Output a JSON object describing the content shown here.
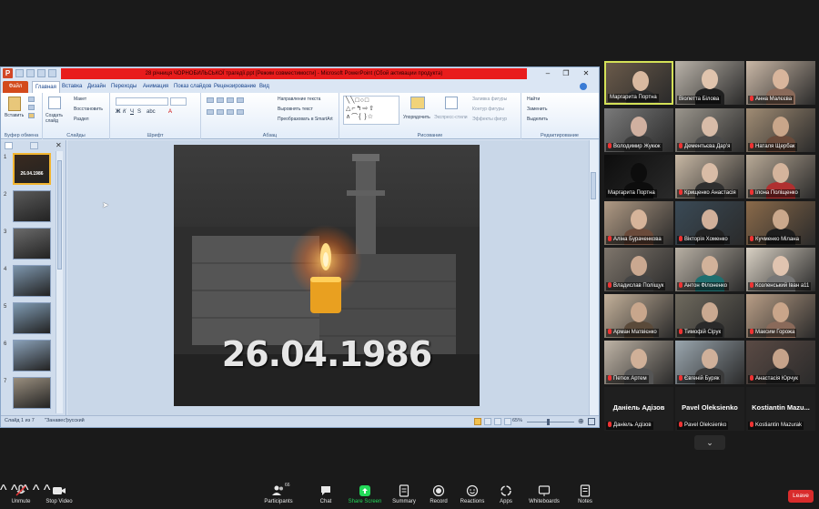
{
  "ppt": {
    "title": "28 річниця ЧОРНОБИЛЬСЬКОЇ трагедії.ppt [Режим совместимости] - Microsoft PowerPoint (Сбой активации продукта)",
    "tabs": [
      "Файл",
      "Главная",
      "Вставка",
      "Дизайн",
      "Переходы",
      "Анимация",
      "Показ слайдов",
      "Рецензирование",
      "Вид"
    ],
    "active_tab": "Главная",
    "ribbon": {
      "paste": "Вставить",
      "clipboard": "Буфер обмена",
      "new_slide": "Создать слайд",
      "layout": "Макет",
      "reset": "Восстановить",
      "section": "Раздел",
      "slides": "Слайды",
      "font": "Шрифт",
      "paragraph": "Абзац",
      "text_direction": "Направление текста",
      "align_text": "Выровнять текст",
      "smartart": "Преобразовать в SmartArt",
      "arrange": "Упорядочить",
      "quick_styles": "Экспресс-стили",
      "shape_fill": "Заливка фигуры",
      "shape_outline": "Контур фигуры",
      "shape_effects": "Эффекты фигур",
      "drawing": "Рисование",
      "find": "Найти",
      "replace": "Заменить",
      "select": "Выделить",
      "editing": "Редактирование"
    },
    "thumbnails": [
      {
        "num": "1",
        "label": "26.04.1986",
        "color": "#3a2a1f"
      },
      {
        "num": "2",
        "label": "",
        "color": "#5a5a5a"
      },
      {
        "num": "3",
        "label": "",
        "color": "#6b6b6b"
      },
      {
        "num": "4",
        "label": "",
        "color": "#7d96ad"
      },
      {
        "num": "5",
        "label": "",
        "color": "#7f9bb3"
      },
      {
        "num": "6",
        "label": "",
        "color": "#8aa1b8"
      },
      {
        "num": "7",
        "label": "",
        "color": "#9a8f7f"
      }
    ],
    "slide_date": "26.04.1986",
    "status": {
      "slide": "Слайд 1 из 7",
      "theme": "\"Занавес\"",
      "lang": "русский",
      "zoom": "65%"
    }
  },
  "participants": [
    {
      "name": "Маргарита Портна",
      "mic": false,
      "active": true,
      "bg": "#6a5a4a",
      "skin": "#d9b9a0",
      "shirt": "#2d2d2d"
    },
    {
      "name": "Віолетта Білова",
      "mic": false,
      "bg": "#b9b2a8",
      "skin": "#e0c4ad",
      "shirt": "#1f1f1f"
    },
    {
      "name": "Анна Малєєва",
      "mic": true,
      "bg": "#c9b7a6",
      "skin": "#d8b59c",
      "shirt": "#8a6a5a"
    },
    {
      "name": "Володимир Жукюк",
      "mic": true,
      "bg": "#7a7a7a",
      "skin": "#d0b0a0",
      "shirt": "#3a3a3a"
    },
    {
      "name": "Дементьєва Дар'я",
      "mic": true,
      "bg": "#9a958c",
      "skin": "#d8bca8",
      "shirt": "#4a4a4a"
    },
    {
      "name": "Наталя Щербак",
      "mic": true,
      "bg": "#a08c74",
      "skin": "#c9a68a",
      "shirt": "#6a4a3a"
    },
    {
      "name": "Маргарита Портна",
      "mic": false,
      "bg": "#0d0d0d",
      "skin": "#0d0d0d",
      "shirt": "#0d0d0d"
    },
    {
      "name": "Крищенко Анастасія",
      "mic": true,
      "bg": "#c8b8a4",
      "skin": "#d9bca6",
      "shirt": "#2f2f2f"
    },
    {
      "name": "Ілона Поліщенко",
      "mic": true,
      "bg": "#b8a996",
      "skin": "#d4b49c",
      "shirt": "#b03030"
    },
    {
      "name": "Аліна Бураченкова",
      "mic": true,
      "bg": "#b09a84",
      "skin": "#d6b49a",
      "shirt": "#6a4a3a"
    },
    {
      "name": "Вікторія Хоменко",
      "mic": true,
      "bg": "#3a4a56",
      "skin": "#d1b09a",
      "shirt": "#222"
    },
    {
      "name": "Кучменко Мілана",
      "mic": true,
      "bg": "#8a6a4a",
      "skin": "#caa88c",
      "shirt": "#1d1d1d"
    },
    {
      "name": "Владислав Поліщук",
      "mic": true,
      "bg": "#7f766c",
      "skin": "#caa890",
      "shirt": "#444"
    },
    {
      "name": "Антон Філоненко",
      "mic": true,
      "bg": "#b8b0a4",
      "skin": "#d2b29a",
      "shirt": "#1f6f6f"
    },
    {
      "name": "Козленський Іван а11",
      "mic": true,
      "bg": "#d9d1c4",
      "skin": "#e0c4b0",
      "shirt": "#777"
    },
    {
      "name": "Арман Матвієнко",
      "mic": true,
      "bg": "#c4b19a",
      "skin": "#c8a68c",
      "shirt": "#5a4a3a"
    },
    {
      "name": "Тимофій Сірук",
      "mic": true,
      "bg": "#6f6a5e",
      "skin": "#c9a991",
      "shirt": "#2a2a2a"
    },
    {
      "name": "Максим Горожа",
      "mic": true,
      "bg": "#b99e86",
      "skin": "#c9a58a",
      "shirt": "#8a6a5a"
    },
    {
      "name": "Петюх Артем",
      "mic": true,
      "bg": "#bfb4a6",
      "skin": "#d0b098",
      "shirt": "#555"
    },
    {
      "name": "Євгеній Буряк",
      "mic": true,
      "bg": "#9aa6ae",
      "skin": "#cfb09a",
      "shirt": "#3a3a3a"
    },
    {
      "name": "Анастасія Юрчук",
      "mic": true,
      "bg": "#5a4a44",
      "skin": "#c6a38a",
      "shirt": "#2a2a2a"
    },
    {
      "name": "Даніель Адізов",
      "big": "Даніель Адізов",
      "mic": true,
      "blank": true
    },
    {
      "name": "Pavel Oleksienko",
      "big": "Pavel Oleksienko",
      "mic": true,
      "blank": true
    },
    {
      "name": "Kostiantin Mazurak",
      "big": "Kostiantin  Mazu...",
      "mic": true,
      "blank": true
    }
  ],
  "toolbar": {
    "unmute": "Unmute",
    "stop_video": "Stop Video",
    "participants": "Participants",
    "participants_count": "66",
    "chat": "Chat",
    "share": "Share Screen",
    "summary": "Summary",
    "record": "Record",
    "reactions": "Reactions",
    "apps": "Apps",
    "whiteboards": "Whiteboards",
    "notes": "Notes",
    "leave": "Leave",
    "colors": {
      "share": "#23d959",
      "leave": "#d92c2c"
    }
  }
}
